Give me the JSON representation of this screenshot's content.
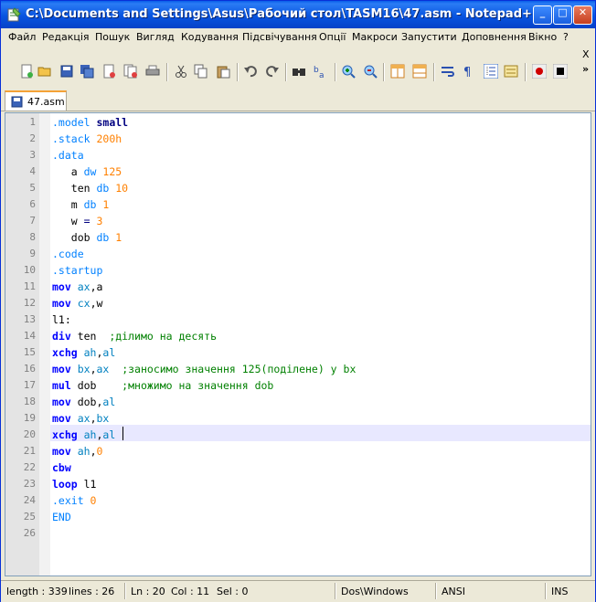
{
  "window": {
    "title": "C:\\Documents and Settings\\Asus\\Рабочий стол\\TASM16\\47.asm - Notepad++",
    "min_glyph": "_",
    "max_glyph": "□",
    "close_glyph": "✕"
  },
  "menu": {
    "items": [
      "Файл",
      "Редакція",
      "Пошук",
      "Вигляд",
      "Кодування",
      "Підсвічування",
      "Опції",
      "Макроси",
      "Запустити",
      "Доповнення",
      "Вікно",
      "?"
    ],
    "close_x": "X"
  },
  "toolbar": {
    "overflow": "»",
    "tools": [
      "new-file-icon",
      "open-file-icon",
      "save-icon",
      "save-all-icon",
      "close-icon",
      "close-all-icon",
      "print-icon",
      "cut-icon",
      "copy-icon",
      "paste-icon",
      "undo-icon",
      "redo-icon",
      "find-icon",
      "replace-icon",
      "zoom-in-icon",
      "zoom-out-icon",
      "sync-vertical-icon",
      "sync-horizontal-icon",
      "word-wrap-icon",
      "show-all-chars-icon",
      "indent-guide-icon",
      "user-lang-icon",
      "record-macro-icon",
      "stop-record-icon"
    ]
  },
  "tab": {
    "label": "47.asm"
  },
  "editor": {
    "line_numbers": [
      "1",
      "2",
      "3",
      "4",
      "5",
      "6",
      "7",
      "8",
      "9",
      "10",
      "11",
      "12",
      "13",
      "14",
      "15",
      "16",
      "17",
      "18",
      "19",
      "20",
      "21",
      "22",
      "23",
      "24",
      "25",
      "26"
    ],
    "current_line": 20,
    "lines": [
      [
        {
          "t": ".model ",
          "c": "dir"
        },
        {
          "t": "small",
          "c": "kwb"
        }
      ],
      [
        {
          "t": ".stack ",
          "c": "dir"
        },
        {
          "t": "200h",
          "c": "num"
        }
      ],
      [
        {
          "t": ".data",
          "c": "dir"
        }
      ],
      [
        {
          "t": "   a ",
          "c": ""
        },
        {
          "t": "dw ",
          "c": "dir"
        },
        {
          "t": "125",
          "c": "num"
        }
      ],
      [
        {
          "t": "   ten ",
          "c": ""
        },
        {
          "t": "db ",
          "c": "dir"
        },
        {
          "t": "10",
          "c": "num"
        }
      ],
      [
        {
          "t": "   m ",
          "c": ""
        },
        {
          "t": "db ",
          "c": "dir"
        },
        {
          "t": "1",
          "c": "num"
        }
      ],
      [
        {
          "t": "   w ",
          "c": ""
        },
        {
          "t": "= ",
          "c": "op"
        },
        {
          "t": "3",
          "c": "num"
        }
      ],
      [
        {
          "t": "   dob ",
          "c": ""
        },
        {
          "t": "db ",
          "c": "dir"
        },
        {
          "t": "1",
          "c": "num"
        }
      ],
      [
        {
          "t": ".code",
          "c": "dir"
        }
      ],
      [
        {
          "t": ".startup",
          "c": "dir"
        }
      ],
      [
        {
          "t": "mov ",
          "c": "kw"
        },
        {
          "t": "ax",
          "c": "reg"
        },
        {
          "t": ",a",
          "c": ""
        }
      ],
      [
        {
          "t": "mov ",
          "c": "kw"
        },
        {
          "t": "cx",
          "c": "reg"
        },
        {
          "t": ",w",
          "c": ""
        }
      ],
      [
        {
          "t": "l1:",
          "c": ""
        }
      ],
      [
        {
          "t": "div ",
          "c": "kw"
        },
        {
          "t": "ten  ",
          "c": ""
        },
        {
          "t": ";ділимо на десять",
          "c": "cm"
        }
      ],
      [
        {
          "t": "xchg ",
          "c": "kw"
        },
        {
          "t": "ah",
          "c": "reg"
        },
        {
          "t": ",",
          "c": ""
        },
        {
          "t": "al",
          "c": "reg"
        }
      ],
      [
        {
          "t": "mov ",
          "c": "kw"
        },
        {
          "t": "bx",
          "c": "reg"
        },
        {
          "t": ",",
          "c": ""
        },
        {
          "t": "ax",
          "c": "reg"
        },
        {
          "t": "  ;заносимо значення 125(поділене) у bx",
          "c": "cm"
        }
      ],
      [
        {
          "t": "mul ",
          "c": "kw"
        },
        {
          "t": "dob    ",
          "c": ""
        },
        {
          "t": ";множимо на значення dob",
          "c": "cm"
        }
      ],
      [
        {
          "t": "mov ",
          "c": "kw"
        },
        {
          "t": "dob,",
          "c": ""
        },
        {
          "t": "al",
          "c": "reg"
        }
      ],
      [
        {
          "t": "mov ",
          "c": "kw"
        },
        {
          "t": "ax",
          "c": "reg"
        },
        {
          "t": ",",
          "c": ""
        },
        {
          "t": "bx",
          "c": "reg"
        }
      ],
      [
        {
          "t": "xchg ",
          "c": "kw"
        },
        {
          "t": "ah",
          "c": "reg"
        },
        {
          "t": ",",
          "c": ""
        },
        {
          "t": "al",
          "c": "reg"
        }
      ],
      [
        {
          "t": "mov ",
          "c": "kw"
        },
        {
          "t": "ah",
          "c": "reg"
        },
        {
          "t": ",",
          "c": ""
        },
        {
          "t": "0",
          "c": "num"
        }
      ],
      [
        {
          "t": "cbw",
          "c": "kw"
        }
      ],
      [
        {
          "t": "loop ",
          "c": "kw"
        },
        {
          "t": "l1",
          "c": ""
        }
      ],
      [
        {
          "t": ".exit ",
          "c": "dir"
        },
        {
          "t": "0",
          "c": "num"
        }
      ],
      [
        {
          "t": "END",
          "c": "dir"
        }
      ],
      [
        {
          "t": "",
          "c": ""
        }
      ]
    ]
  },
  "status": {
    "length": "length : 339",
    "lines": "lines : 26",
    "ln": "Ln : 20",
    "col": "Col : 11",
    "sel": "Sel : 0",
    "eol": "Dos\\Windows",
    "encoding": "ANSI",
    "mode": "INS"
  },
  "colors": {
    "title_bar": "#0854e0",
    "keyword": "#0000ff",
    "directive": "#0080ff",
    "number": "#ff8000",
    "comment": "#008000",
    "current_line": "#e8e8ff"
  }
}
